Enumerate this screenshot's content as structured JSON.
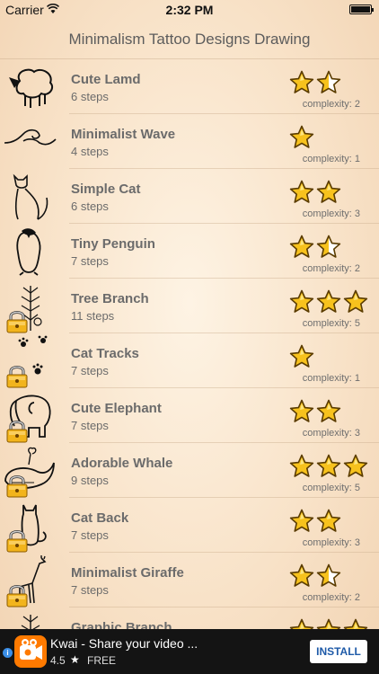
{
  "status_bar": {
    "carrier": "Carrier",
    "time": "2:32 PM"
  },
  "nav": {
    "title": "Minimalism Tattoo Designs Drawing"
  },
  "items": [
    {
      "title": "Cute Lamd",
      "steps": "6 steps",
      "complexity": "complexity: 2",
      "stars": [
        1,
        0.5,
        0
      ],
      "locked": false,
      "icon": "lamb-icon"
    },
    {
      "title": "Minimalist Wave",
      "steps": "4 steps",
      "complexity": "complexity: 1",
      "stars": [
        1,
        0,
        0
      ],
      "locked": false,
      "icon": "wave-icon"
    },
    {
      "title": "Simple Cat",
      "steps": "6 steps",
      "complexity": "complexity: 3",
      "stars": [
        1,
        1,
        0
      ],
      "locked": false,
      "icon": "cat-icon"
    },
    {
      "title": "Tiny Penguin",
      "steps": "7 steps",
      "complexity": "complexity: 2",
      "stars": [
        1,
        0.5,
        0
      ],
      "locked": false,
      "icon": "penguin-icon"
    },
    {
      "title": "Tree Branch",
      "steps": "11 steps",
      "complexity": "complexity: 5",
      "stars": [
        1,
        1,
        1
      ],
      "locked": true,
      "icon": "branch-icon"
    },
    {
      "title": "Cat Tracks",
      "steps": "7 steps",
      "complexity": "complexity: 1",
      "stars": [
        1,
        0,
        0
      ],
      "locked": true,
      "icon": "paw-icon"
    },
    {
      "title": "Cute Elephant",
      "steps": "7 steps",
      "complexity": "complexity: 3",
      "stars": [
        1,
        1,
        0
      ],
      "locked": true,
      "icon": "elephant-icon"
    },
    {
      "title": "Adorable Whale",
      "steps": "9 steps",
      "complexity": "complexity: 5",
      "stars": [
        1,
        1,
        1
      ],
      "locked": true,
      "icon": "whale-icon"
    },
    {
      "title": "Cat Back",
      "steps": "7 steps",
      "complexity": "complexity: 3",
      "stars": [
        1,
        1,
        0
      ],
      "locked": true,
      "icon": "cat-back-icon"
    },
    {
      "title": "Minimalist Giraffe",
      "steps": "7 steps",
      "complexity": "complexity: 2",
      "stars": [
        1,
        0.5,
        0
      ],
      "locked": true,
      "icon": "giraffe-icon"
    },
    {
      "title": "Graphic Branch",
      "steps": "",
      "complexity": "",
      "stars": [
        1,
        1,
        1
      ],
      "locked": true,
      "icon": "branch-icon"
    }
  ],
  "ad": {
    "title": "Kwai - Share your video ...",
    "rating": "4.5",
    "price": "FREE",
    "install": "INSTALL"
  }
}
